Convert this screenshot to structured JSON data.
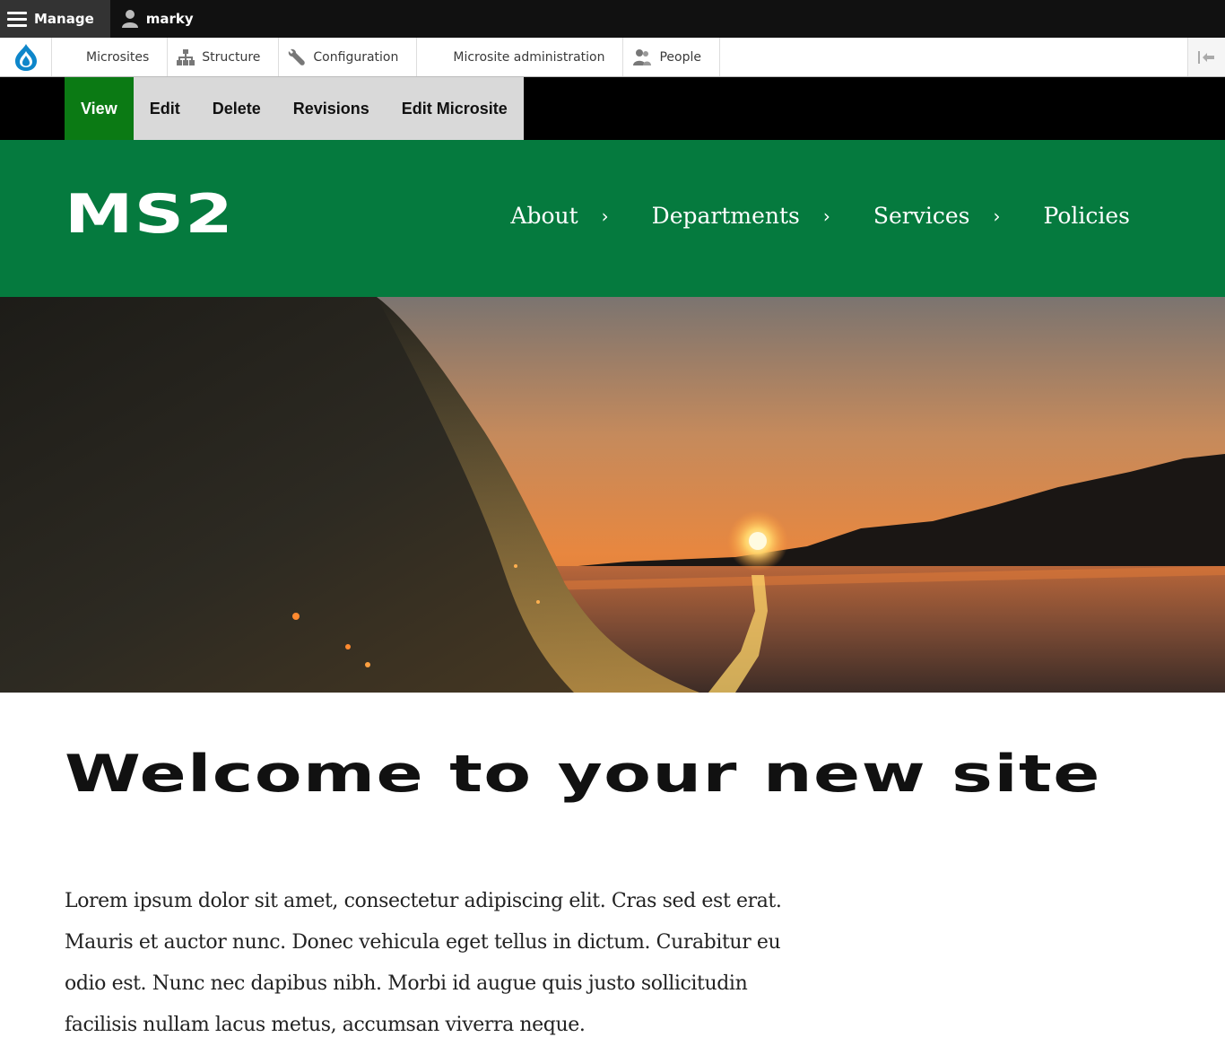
{
  "admin_toolbar": {
    "manage_label": "Manage",
    "user_label": "marky"
  },
  "tray": {
    "items": [
      {
        "label": "Microsites",
        "icon": "none"
      },
      {
        "label": "Structure",
        "icon": "structure-icon"
      },
      {
        "label": "Configuration",
        "icon": "wrench-icon"
      },
      {
        "label": "Microsite administration",
        "icon": "none"
      },
      {
        "label": "People",
        "icon": "people-icon"
      }
    ]
  },
  "local_tasks": {
    "items": [
      "View",
      "Edit",
      "Delete",
      "Revisions",
      "Edit Microsite"
    ],
    "active": "View"
  },
  "site": {
    "name": "MS2",
    "nav": [
      {
        "label": "About",
        "has_children": true
      },
      {
        "label": "Departments",
        "has_children": true
      },
      {
        "label": "Services",
        "has_children": true
      },
      {
        "label": "Policies",
        "has_children": false
      }
    ]
  },
  "content": {
    "title": "Welcome to your new site",
    "body": "Lorem ipsum dolor sit amet, consectetur adipiscing elit. Cras sed est erat. Mauris et auctor nunc. Donec vehicula eget tellus in dictum. Curabitur eu odio est. Nunc nec dapibus nibh. Morbi id augue quis justo sollicitudin facilisis nullam lacus metus, accumsan viverra neque."
  },
  "colors": {
    "admin_bar": "#111111",
    "header_green": "#057a3e",
    "active_tab_green": "#0b7a14",
    "drupal_blue": "#0e86ca"
  }
}
